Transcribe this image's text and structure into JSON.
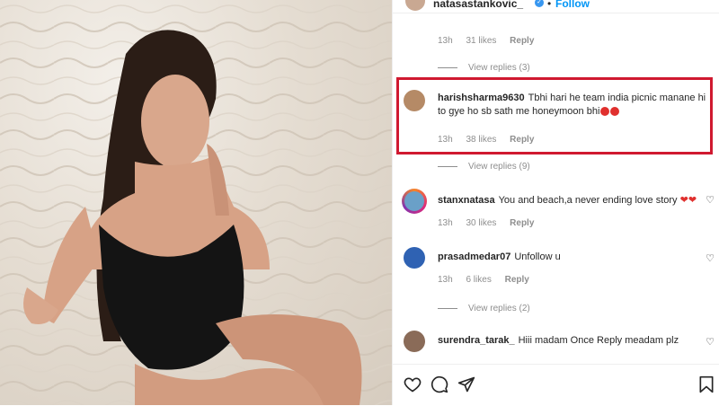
{
  "post": {
    "username": "natasastankovic_",
    "follow_label": "Follow"
  },
  "comments": [
    {
      "likes": "31 likes",
      "time": "13h",
      "reply": "Reply",
      "view_replies": "View replies (3)"
    },
    {
      "username": "harishsharma9630",
      "text": "Tbhi hari he team india picnic manane hi to gye ho sb sath me honeymoon bhi",
      "time": "13h",
      "likes": "38 likes",
      "reply": "Reply",
      "view_replies": "View replies (9)"
    },
    {
      "username": "stanxnatasa",
      "text": "You and beach,a never ending love story",
      "time": "13h",
      "likes": "30 likes",
      "reply": "Reply"
    },
    {
      "username": "prasadmedar07",
      "text": "Unfollow u",
      "time": "13h",
      "likes": "6 likes",
      "reply": "Reply",
      "view_replies": "View replies (2)"
    },
    {
      "username": "surendra_tarak_",
      "text": "Hiii madam Once Reply meadam plz"
    }
  ],
  "icons": {
    "like": "heart-icon",
    "comment": "comment-icon",
    "share": "share-icon",
    "save": "bookmark-icon"
  },
  "colors": {
    "highlight": "#d01930",
    "link": "#0095f6",
    "muted": "#8e8e8e",
    "heart_red": "#e0302e"
  }
}
